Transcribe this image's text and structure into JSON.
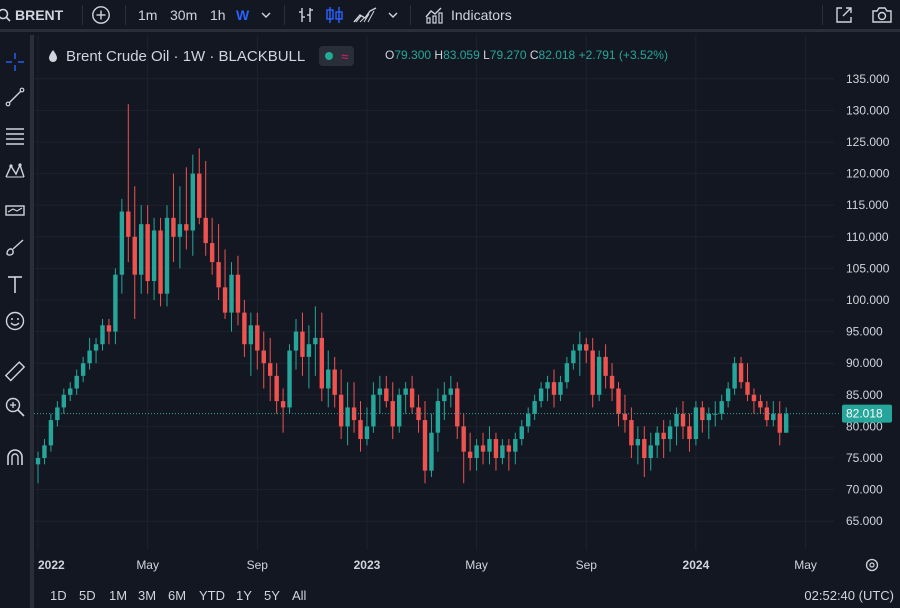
{
  "toolbar": {
    "symbol": "BRENT",
    "intervals": [
      "1m",
      "30m",
      "1h",
      "W"
    ],
    "active_interval": "W",
    "indicators_label": "Indicators"
  },
  "legend": {
    "title": "Brent Crude Oil · 1W · BLACKBULL",
    "open_key": "O",
    "open": "79.300",
    "high_key": "H",
    "high": "83.059",
    "low_key": "L",
    "low": "79.270",
    "close_key": "C",
    "close": "82.018",
    "change": "+2.791 (+3.52%)"
  },
  "bottom": {
    "ranges": [
      "1D",
      "5D",
      "1M",
      "3M",
      "6M",
      "YTD",
      "1Y",
      "5Y",
      "All"
    ],
    "clock": "02:52:40 (UTC)"
  },
  "colors": {
    "up": "#26a69a",
    "down": "#ef5350",
    "accent": "#2962ff",
    "price_label": "#26a69a"
  },
  "chart_data": {
    "type": "candlestick",
    "title": "Brent Crude Oil · 1W · BLACKBULL",
    "y_ticks": [
      "135.000",
      "130.000",
      "125.000",
      "120.000",
      "115.000",
      "110.000",
      "105.000",
      "100.000",
      "95.000",
      "90.000",
      "85.000",
      "80.000",
      "75.000",
      "70.000",
      "65.000"
    ],
    "y_range": [
      62.5,
      137.5
    ],
    "x_labels": [
      {
        "label": "2022",
        "index": 0
      },
      {
        "label": "May",
        "index": 17
      },
      {
        "label": "Sep",
        "index": 34
      },
      {
        "label": "2023",
        "index": 51
      },
      {
        "label": "May",
        "index": 68
      },
      {
        "label": "Sep",
        "index": 85
      },
      {
        "label": "2024",
        "index": 102
      },
      {
        "label": "May",
        "index": 119
      }
    ],
    "current_price": "82.018",
    "current_price_value": 82.018,
    "series": [
      [
        74,
        76,
        71,
        75
      ],
      [
        75,
        78,
        74,
        77
      ],
      [
        77,
        82,
        76,
        81
      ],
      [
        81,
        84,
        80,
        83
      ],
      [
        83,
        86,
        82,
        85
      ],
      [
        85,
        87,
        84,
        86
      ],
      [
        86,
        89,
        85,
        88
      ],
      [
        88,
        91,
        87,
        90
      ],
      [
        90,
        94,
        89,
        92
      ],
      [
        92,
        94,
        90,
        93
      ],
      [
        93,
        97,
        92,
        96
      ],
      [
        96,
        97,
        93,
        95
      ],
      [
        95,
        105,
        93,
        104
      ],
      [
        104,
        116,
        101,
        114
      ],
      [
        114,
        131,
        106,
        110
      ],
      [
        110,
        118,
        97,
        104
      ],
      [
        104,
        115,
        101,
        112
      ],
      [
        112,
        115,
        101,
        103
      ],
      [
        103,
        113,
        100,
        111
      ],
      [
        111,
        113,
        99,
        101
      ],
      [
        101,
        115,
        99,
        113
      ],
      [
        113,
        120,
        106,
        110
      ],
      [
        110,
        118,
        105,
        112
      ],
      [
        112,
        121,
        108,
        111
      ],
      [
        111,
        123,
        107,
        120
      ],
      [
        120,
        124,
        112,
        113
      ],
      [
        113,
        122,
        107,
        109
      ],
      [
        109,
        113,
        104,
        106
      ],
      [
        106,
        112,
        100,
        102
      ],
      [
        102,
        108,
        97,
        98
      ],
      [
        98,
        106,
        95,
        104
      ],
      [
        104,
        107,
        96,
        98
      ],
      [
        98,
        100,
        91,
        93
      ],
      [
        93,
        98,
        88,
        96
      ],
      [
        96,
        98,
        89,
        92
      ],
      [
        92,
        95,
        86,
        90
      ],
      [
        90,
        94,
        84,
        88
      ],
      [
        88,
        90,
        82,
        84
      ],
      [
        84,
        86,
        79,
        83
      ],
      [
        83,
        93,
        82,
        92
      ],
      [
        92,
        97,
        89,
        95
      ],
      [
        95,
        98,
        88,
        91
      ],
      [
        91,
        96,
        86,
        93
      ],
      [
        93,
        99,
        88,
        94
      ],
      [
        94,
        98,
        84,
        86
      ],
      [
        86,
        92,
        83,
        89
      ],
      [
        89,
        91,
        83,
        85
      ],
      [
        85,
        89,
        78,
        80
      ],
      [
        80,
        87,
        77,
        83
      ],
      [
        83,
        87,
        79,
        81
      ],
      [
        81,
        84,
        76,
        78
      ],
      [
        78,
        83,
        77,
        80
      ],
      [
        80,
        87,
        79,
        85
      ],
      [
        85,
        88,
        82,
        86
      ],
      [
        86,
        88,
        83,
        84
      ],
      [
        84,
        87,
        78,
        80
      ],
      [
        80,
        86,
        79,
        85
      ],
      [
        85,
        87,
        82,
        86
      ],
      [
        86,
        88,
        82,
        83
      ],
      [
        83,
        85,
        79,
        81
      ],
      [
        81,
        84,
        71,
        73
      ],
      [
        73,
        82,
        72,
        79
      ],
      [
        79,
        86,
        76,
        84
      ],
      [
        84,
        87,
        81,
        85
      ],
      [
        85,
        88,
        83,
        86
      ],
      [
        86,
        87,
        78,
        80
      ],
      [
        80,
        82,
        71,
        76
      ],
      [
        76,
        79,
        73,
        75
      ],
      [
        75,
        78,
        73,
        77
      ],
      [
        77,
        79,
        74,
        76
      ],
      [
        76,
        80,
        74,
        78
      ],
      [
        78,
        79,
        73,
        75
      ],
      [
        75,
        78,
        74,
        77
      ],
      [
        77,
        78,
        73,
        76
      ],
      [
        76,
        79,
        74,
        78
      ],
      [
        78,
        81,
        77,
        80
      ],
      [
        80,
        83,
        79,
        82
      ],
      [
        82,
        85,
        81,
        84
      ],
      [
        84,
        87,
        83,
        86
      ],
      [
        86,
        88,
        84,
        87
      ],
      [
        87,
        89,
        83,
        85
      ],
      [
        85,
        88,
        84,
        87
      ],
      [
        87,
        91,
        86,
        90
      ],
      [
        90,
        93,
        89,
        92
      ],
      [
        92,
        95,
        88,
        93
      ],
      [
        93,
        94,
        90,
        92
      ],
      [
        92,
        94,
        83,
        85
      ],
      [
        85,
        92,
        84,
        91
      ],
      [
        91,
        93,
        86,
        88
      ],
      [
        88,
        90,
        84,
        86
      ],
      [
        86,
        87,
        80,
        82
      ],
      [
        82,
        85,
        79,
        81
      ],
      [
        81,
        83,
        75,
        77
      ],
      [
        77,
        80,
        74,
        78
      ],
      [
        78,
        80,
        72,
        75
      ],
      [
        75,
        79,
        73,
        77
      ],
      [
        77,
        80,
        75,
        79
      ],
      [
        79,
        81,
        75,
        78
      ],
      [
        78,
        81,
        76,
        80
      ],
      [
        80,
        83,
        77,
        82
      ],
      [
        82,
        84,
        78,
        80
      ],
      [
        80,
        82,
        76,
        78
      ],
      [
        78,
        84,
        77,
        83
      ],
      [
        83,
        84,
        79,
        81
      ],
      [
        81,
        83,
        78,
        82
      ],
      [
        82,
        84,
        80,
        82
      ],
      [
        82,
        85,
        81,
        84
      ],
      [
        84,
        87,
        83,
        86
      ],
      [
        86,
        91,
        85,
        90
      ],
      [
        90,
        91,
        86,
        87
      ],
      [
        87,
        90,
        84,
        85
      ],
      [
        85,
        86,
        82,
        84
      ],
      [
        84,
        85,
        82,
        83
      ],
      [
        83,
        84,
        80,
        81
      ],
      [
        81,
        84,
        80,
        82
      ],
      [
        82,
        84,
        77,
        79
      ],
      [
        79,
        83,
        79,
        82
      ]
    ]
  }
}
